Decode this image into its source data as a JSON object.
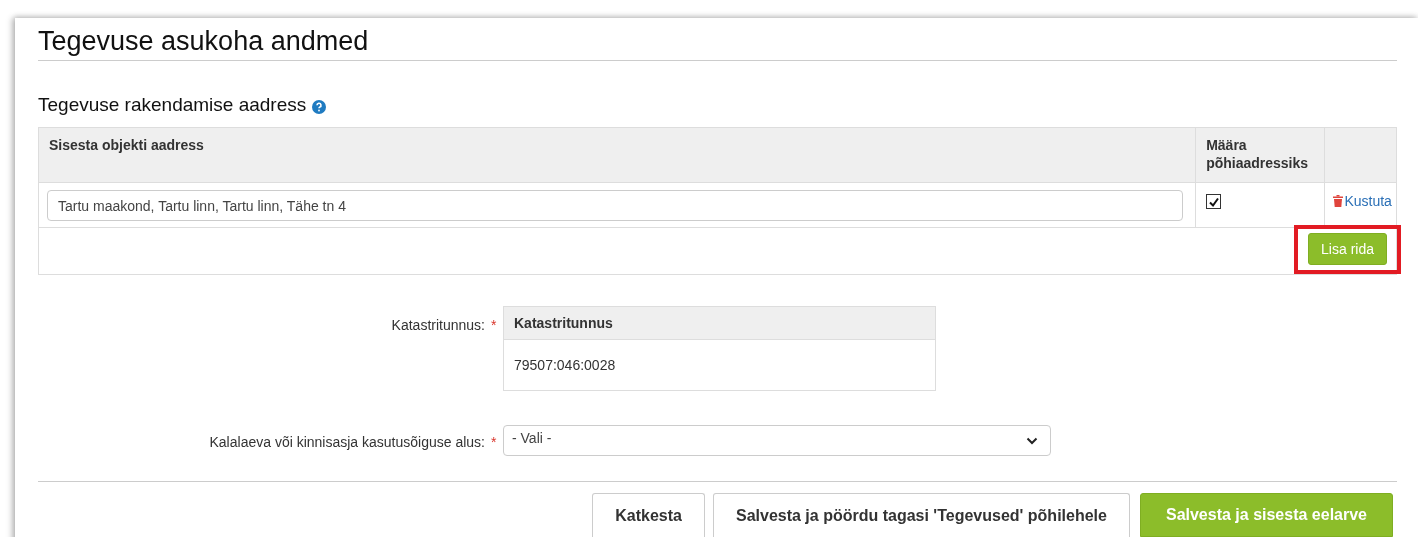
{
  "title": "Tegevuse asukoha andmed",
  "address_section": {
    "heading": "Tegevuse rakendamise aadress",
    "columns": [
      "Sisesta objekti aadress",
      "Määra põhiaadressiks"
    ],
    "rows": [
      {
        "address": "Tartu maakond, Tartu linn, Tartu linn, Tähe tn 4",
        "main": true,
        "delete": "Kustuta"
      }
    ],
    "add_button": {
      "label": "Lisa rida",
      "highlighted": true
    }
  },
  "cadastral": {
    "label": "Katastritunnus:",
    "required_mark": "*",
    "column": "Katastritunnus",
    "values": [
      "79507:046:0028"
    ]
  },
  "basis": {
    "label": "Kalalaeva või kinnisasja kasutusõiguse alus:",
    "required_mark": "*",
    "value": "- Vali -"
  },
  "buttons": [
    {
      "label": "Katkesta",
      "kind": "default"
    },
    {
      "label": "Salvesta ja pöördu tagasi 'Tegevused' põhilehele",
      "kind": "default"
    },
    {
      "label": "Salvesta ja sisesta eelarve",
      "kind": "primary"
    }
  ]
}
